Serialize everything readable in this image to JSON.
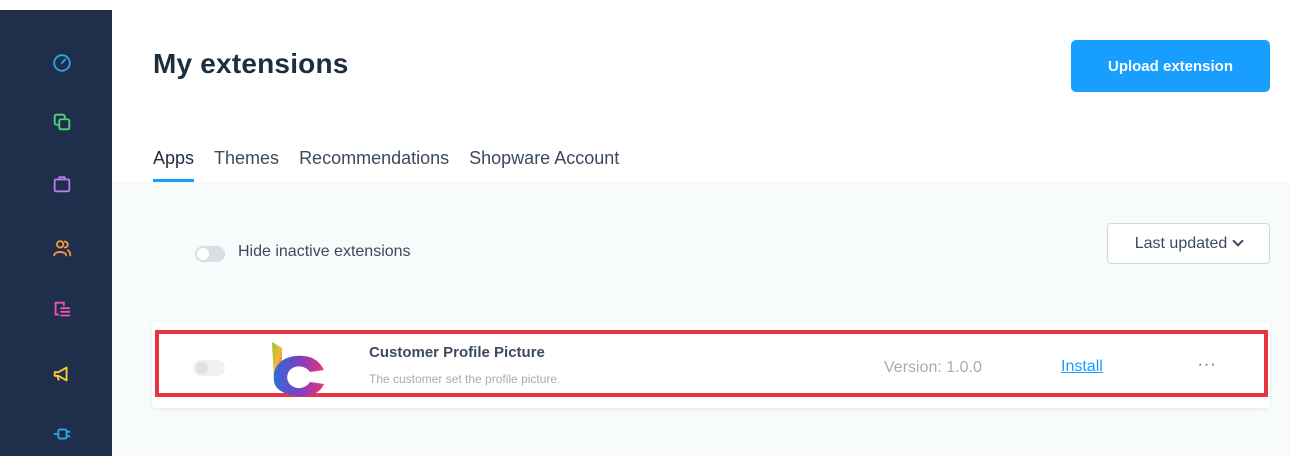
{
  "header": {
    "title": "My extensions",
    "upload_label": "Upload extension"
  },
  "tabs": [
    {
      "label": "Apps",
      "active": true
    },
    {
      "label": "Themes",
      "active": false
    },
    {
      "label": "Recommendations",
      "active": false
    },
    {
      "label": "Shopware Account",
      "active": false
    }
  ],
  "filters": {
    "hide_inactive_label": "Hide inactive extensions",
    "sort_label": "Last updated"
  },
  "extension": {
    "name": "Customer Profile Picture",
    "description": "The customer set the profile picture.",
    "version": "Version: 1.0.0",
    "install_label": "Install",
    "more_label": "···"
  },
  "sidebar": {
    "icons": [
      "dashboard-icon",
      "catalogue-icon",
      "orders-icon",
      "customers-icon",
      "content-icon",
      "marketing-icon",
      "extensions-icon"
    ]
  },
  "colors": {
    "sidebar_bg": "#1f2f4b",
    "primary": "#189eff",
    "highlight": "#e8353f"
  }
}
